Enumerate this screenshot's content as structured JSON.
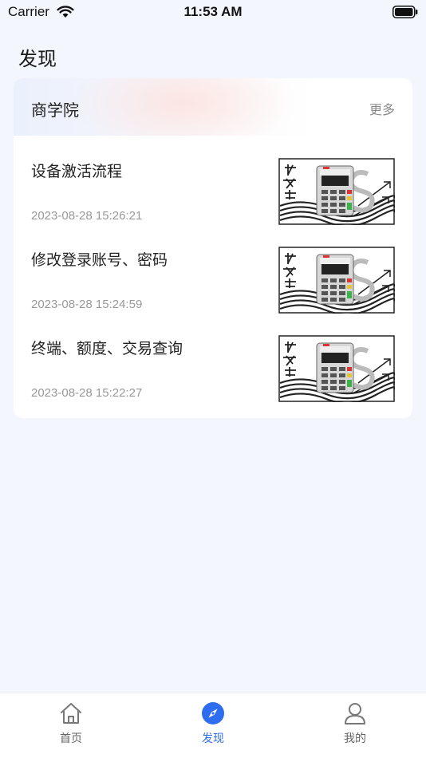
{
  "status_bar": {
    "carrier": "Carrier",
    "time": "11:53 AM"
  },
  "page": {
    "title": "发现"
  },
  "business_school": {
    "title": "商学院",
    "more_label": "更多",
    "articles": [
      {
        "title": "设备激活流程",
        "time": "2023-08-28 15:26:21",
        "thumb_icon": "pos-terminal-thumbnail"
      },
      {
        "title": "修改登录账号、密码",
        "time": "2023-08-28 15:24:59",
        "thumb_icon": "pos-terminal-thumbnail"
      },
      {
        "title": "终端、额度、交易查询",
        "time": "2023-08-28 15:22:27",
        "thumb_icon": "pos-terminal-thumbnail"
      }
    ]
  },
  "tab_bar": {
    "tabs": [
      {
        "label": "首页",
        "icon": "home-icon"
      },
      {
        "label": "发现",
        "icon": "compass-icon",
        "active": true
      },
      {
        "label": "我的",
        "icon": "user-icon"
      }
    ]
  },
  "colors": {
    "accent": "#2f6df0",
    "background": "#f3f6fc",
    "muted_text": "#999999"
  }
}
